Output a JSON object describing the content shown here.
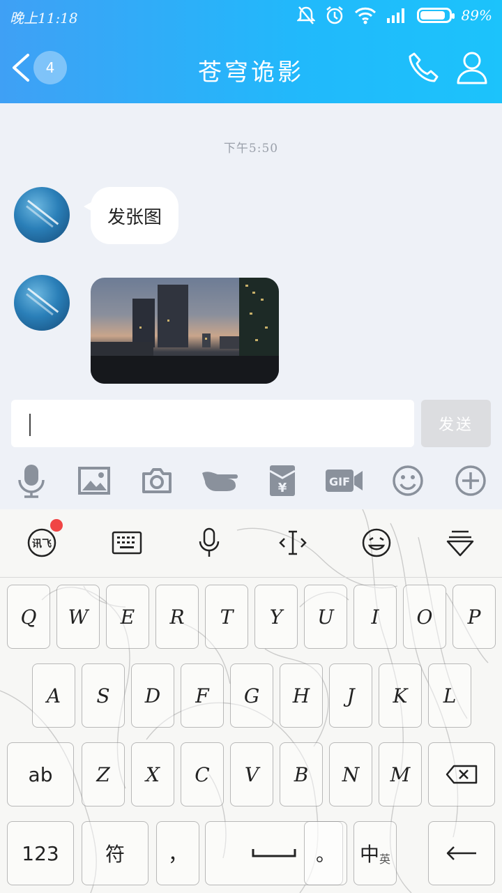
{
  "status_bar": {
    "time": "晚上11:18",
    "battery_percent": "89%",
    "battery_level": 0.89
  },
  "header": {
    "unread_count": "4",
    "title": "苍穹诡影"
  },
  "chat": {
    "timestamp": "下午5:50",
    "messages": [
      {
        "type": "text",
        "text": "发张图"
      },
      {
        "type": "image"
      }
    ]
  },
  "composer": {
    "input_value": "",
    "send_label": "发送"
  },
  "toolbar": {
    "items": [
      "microphone-icon",
      "image-icon",
      "camera-icon",
      "poke-icon",
      "red-packet-icon",
      "gif-icon",
      "emoji-icon",
      "plus-icon"
    ],
    "red_packet_glyph": "¥",
    "gif_label": "GIF"
  },
  "keyboard_toolbar": {
    "items": [
      "ifly-icon",
      "keyboard-icon",
      "voice-input-icon",
      "cursor-icon",
      "emoji-face-icon",
      "hide-keyboard-icon"
    ],
    "ifly_label": "讯飞"
  },
  "keyboard": {
    "row1": [
      "Q",
      "W",
      "E",
      "R",
      "T",
      "Y",
      "U",
      "I",
      "O",
      "P"
    ],
    "row2": [
      "A",
      "S",
      "D",
      "F",
      "G",
      "H",
      "J",
      "K",
      "L"
    ],
    "row3": [
      "Z",
      "X",
      "C",
      "V",
      "B",
      "N",
      "M"
    ],
    "shift_label": "ab",
    "numbers_label": "123",
    "symbols_label": "符",
    "comma_label": "，",
    "period_label": "。",
    "lang_label": "中",
    "lang_sub_label": "英"
  }
}
